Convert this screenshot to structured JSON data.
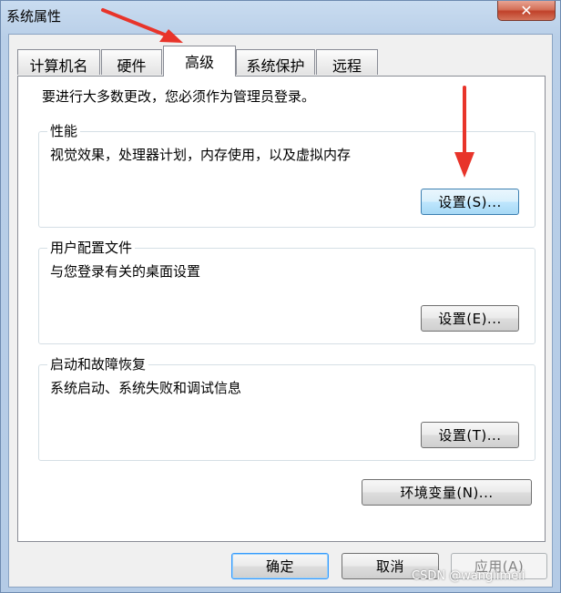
{
  "window": {
    "title": "系统属性",
    "close_glyph": "✕"
  },
  "tabs": [
    {
      "label": "计算机名",
      "active": false
    },
    {
      "label": "硬件",
      "active": false
    },
    {
      "label": "高级",
      "active": true
    },
    {
      "label": "系统保护",
      "active": false
    },
    {
      "label": "远程",
      "active": false
    }
  ],
  "advanced": {
    "intro": "要进行大多数更改，您必须作为管理员登录。",
    "performance": {
      "label": "性能",
      "description": "视觉效果，处理器计划，内存使用，以及虚拟内存",
      "button": "设置(S)..."
    },
    "user_profiles": {
      "label": "用户配置文件",
      "description": "与您登录有关的桌面设置",
      "button": "设置(E)..."
    },
    "startup_recovery": {
      "label": "启动和故障恢复",
      "description": "系统启动、系统失败和调试信息",
      "button": "设置(T)..."
    },
    "env_button": "环境变量(N)..."
  },
  "footer": {
    "ok": "确定",
    "cancel": "取消",
    "apply": "应用(A)"
  },
  "watermark": "CSDN @wanglimeii",
  "colors": {
    "arrow": "#e8342a",
    "accent": "#3399ff"
  }
}
